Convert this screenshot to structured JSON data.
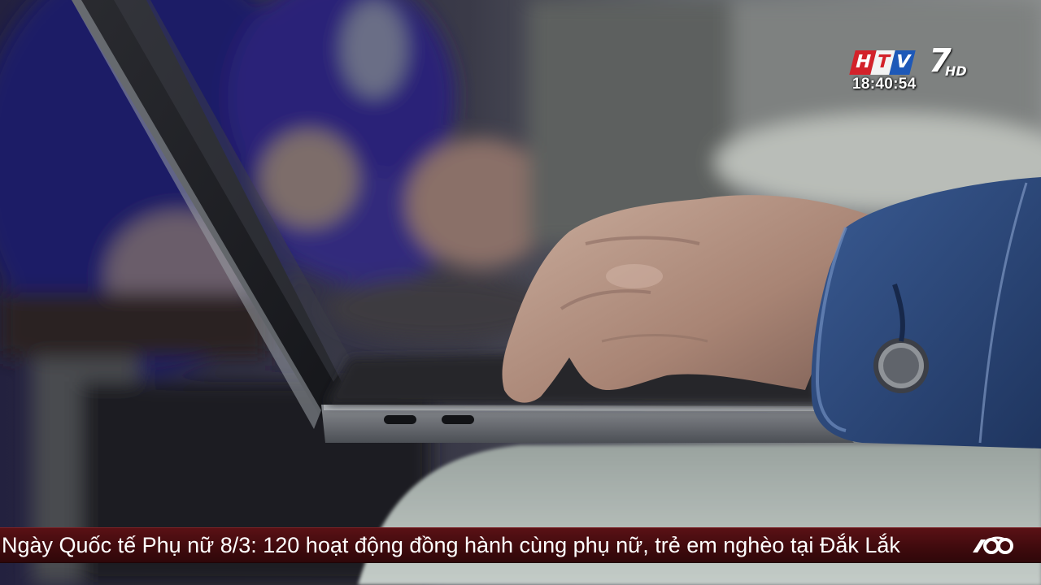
{
  "broadcast": {
    "channel_logo": {
      "letters": [
        "H",
        "T",
        "V"
      ],
      "number": "7",
      "suffix": "HD"
    },
    "clock": "18:40:54"
  },
  "ticker": {
    "headline": "Ngày Quốc tế Phụ nữ 8/3: 120 hoạt động đồng hành cùng phụ nữ, trẻ em nghèo tại Đắk Lắk",
    "end_icon": "sixty-seconds-logo-icon"
  },
  "scene": {
    "subject": "hand typing on a laptop keyboard",
    "colors": {
      "ticker": "#3e0a0d",
      "sleeve": "#2c4a80",
      "laptop": "#6d7075"
    }
  }
}
